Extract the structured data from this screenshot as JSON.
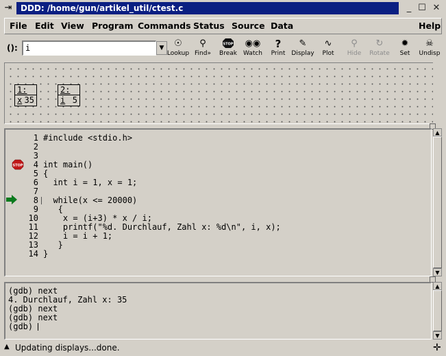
{
  "window": {
    "title": "DDD: /home/gun/artikel_util/ctest.c",
    "buttons": {
      "minimize": "_",
      "maximize": "☐",
      "close": "✕"
    }
  },
  "menu": {
    "items": [
      {
        "label": "File"
      },
      {
        "label": "Edit"
      },
      {
        "label": "View"
      },
      {
        "label": "Program"
      },
      {
        "label": "Commands"
      },
      {
        "label": "Status"
      },
      {
        "label": "Source"
      },
      {
        "label": "Data"
      },
      {
        "label": "Help"
      }
    ]
  },
  "argument": {
    "label": "():",
    "value": "i"
  },
  "toolbar": {
    "buttons": [
      {
        "label": "Lookup",
        "icon": "lookup-icon",
        "glyph": "☉",
        "enabled": true
      },
      {
        "label": "Find»",
        "icon": "find-icon",
        "glyph": "⚲",
        "enabled": true
      },
      {
        "label": "Break",
        "icon": "stop-sign-icon",
        "glyph": "⬣",
        "enabled": true
      },
      {
        "label": "Watch",
        "icon": "watch-eyes-icon",
        "glyph": "◉◉",
        "enabled": true
      },
      {
        "label": "Print",
        "icon": "print-icon",
        "glyph": "?",
        "enabled": true
      },
      {
        "label": "Display",
        "icon": "display-icon",
        "glyph": "✎",
        "enabled": true
      },
      {
        "label": "Plot",
        "icon": "plot-icon",
        "glyph": "∿",
        "enabled": true
      },
      {
        "label": "Hide",
        "icon": "hide-icon",
        "glyph": "⚲",
        "enabled": false
      },
      {
        "label": "Rotate",
        "icon": "rotate-icon",
        "glyph": "↻",
        "enabled": false
      },
      {
        "label": "Set",
        "icon": "set-icon",
        "glyph": "✹",
        "enabled": true
      },
      {
        "label": "Undisp",
        "icon": "undisplay-icon",
        "glyph": "☠",
        "enabled": true
      }
    ]
  },
  "displays": [
    {
      "number": "1:",
      "name": "x",
      "value": "35"
    },
    {
      "number": "2:",
      "name": "i",
      "value": "5"
    }
  ],
  "source": {
    "breakpoint_label": "STOP",
    "breakpoint_line": 4,
    "current_line": 8,
    "lines": [
      {
        "num": "1",
        "text": "#include <stdio.h>"
      },
      {
        "num": "2",
        "text": ""
      },
      {
        "num": "3",
        "text": ""
      },
      {
        "num": "4",
        "text": "int main()"
      },
      {
        "num": "5",
        "text": "{"
      },
      {
        "num": "6",
        "text": "  int i = 1, x = 1;"
      },
      {
        "num": "7",
        "text": ""
      },
      {
        "num": "8",
        "text": "  while(x <= 20000)"
      },
      {
        "num": "9",
        "text": "   {"
      },
      {
        "num": "10",
        "text": "    x = (i+3) * x / i;"
      },
      {
        "num": "11",
        "text": "    printf(\"%d. Durchlauf, Zahl x: %d\\n\", i, x);"
      },
      {
        "num": "12",
        "text": "    i = i + 1;"
      },
      {
        "num": "13",
        "text": "   }"
      },
      {
        "num": "14",
        "text": "}"
      }
    ]
  },
  "console": {
    "lines": [
      "(gdb) next",
      "4. Durchlauf, Zahl x: 35",
      "(gdb) next",
      "(gdb) next",
      "(gdb) "
    ]
  },
  "status": {
    "text": "Updating displays...done."
  },
  "colors": {
    "title_bg": "#0a1f82",
    "exec_arrow": "#0a7a1e",
    "stop_sign": "#c01818"
  }
}
